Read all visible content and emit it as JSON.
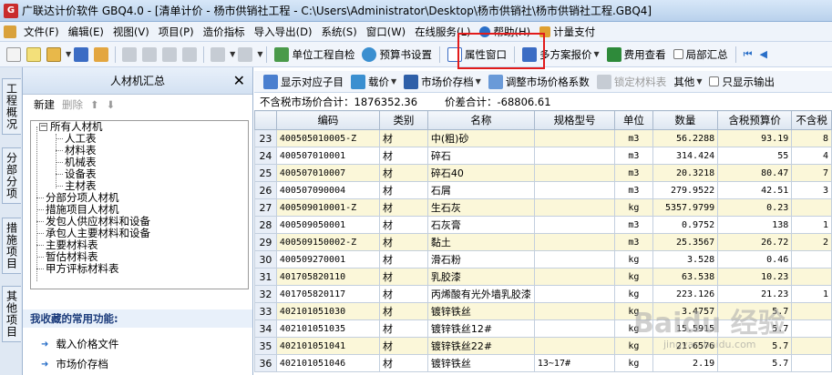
{
  "window": {
    "title": "广联达计价软件 GBQ4.0 - [清单计价 - 杨市供销社工程 - C:\\Users\\Administrator\\Desktop\\杨市供销社\\杨市供销社工程.GBQ4]"
  },
  "menu": [
    {
      "label": "文件(F)"
    },
    {
      "label": "编辑(E)"
    },
    {
      "label": "视图(V)"
    },
    {
      "label": "项目(P)"
    },
    {
      "label": "造价指标"
    },
    {
      "label": "导入导出(D)"
    },
    {
      "label": "系统(S)"
    },
    {
      "label": "窗口(W)"
    },
    {
      "label": "在线服务(L)"
    },
    {
      "label": "帮助(H)"
    },
    {
      "label": "计量支付"
    }
  ],
  "toolbar1": {
    "unit_check": "单位工程自检",
    "budget_settings": "预算书设置",
    "property_window": "属性窗口",
    "multi_quote": "多方案报价",
    "fee_view": "费用查看",
    "local_summary": "局部汇总"
  },
  "vtabs": [
    "工程概况",
    "分部分项",
    "措施项目",
    "其他项目"
  ],
  "left_panel": {
    "title": "人材机汇总",
    "new_label": "新建",
    "delete_label": "删除",
    "tree": {
      "root": "所有人材机",
      "children": [
        "人工表",
        "材料表",
        "机械表",
        "设备表",
        "主材表"
      ],
      "siblings": [
        "分部分项人材机",
        "措施项目人材机",
        "发包人供应材料和设备",
        "承包人主要材料和设备",
        "主要材料表",
        "暂估材料表",
        "甲方评标材料表"
      ]
    },
    "favorites_title": "我收藏的常用功能:",
    "favorites": [
      "载入价格文件",
      "市场价存档"
    ]
  },
  "toolbar2": {
    "show_sub": "显示对应子目",
    "load_price": "载价",
    "market_archive": "市场价存档",
    "adjust_coef": "调整市场价格系数",
    "lock_material": "锁定材料表",
    "other": "其他",
    "show_output": "只显示输出"
  },
  "summary": {
    "pretax_total": "不含税市场价合计：1876352.36",
    "diff_total": "价差合计：-68806.61"
  },
  "table": {
    "columns": [
      "",
      "编码",
      "类别",
      "名称",
      "规格型号",
      "单位",
      "数量",
      "含税预算价",
      "不含税"
    ],
    "rows": [
      [
        "23",
        "400505010005-Z",
        "材",
        "中(粗)砂",
        "",
        "m3",
        "56.2288",
        "93.19",
        "8"
      ],
      [
        "24",
        "400507010001",
        "材",
        "碎石",
        "",
        "m3",
        "314.424",
        "55",
        "4"
      ],
      [
        "25",
        "400507010007",
        "材",
        "碎石40",
        "",
        "m3",
        "20.3218",
        "80.47",
        "7"
      ],
      [
        "26",
        "400507090004",
        "材",
        "石屑",
        "",
        "m3",
        "279.9522",
        "42.51",
        "3"
      ],
      [
        "27",
        "400509010001-Z",
        "材",
        "生石灰",
        "",
        "kg",
        "5357.9799",
        "0.23",
        ""
      ],
      [
        "28",
        "400509050001",
        "材",
        "石灰膏",
        "",
        "m3",
        "0.9752",
        "138",
        "1"
      ],
      [
        "29",
        "400509150002-Z",
        "材",
        "黏土",
        "",
        "m3",
        "25.3567",
        "26.72",
        "2"
      ],
      [
        "30",
        "400509270001",
        "材",
        "滑石粉",
        "",
        "kg",
        "3.528",
        "0.46",
        ""
      ],
      [
        "31",
        "401705820110",
        "材",
        "乳胶漆",
        "",
        "kg",
        "63.538",
        "10.23",
        ""
      ],
      [
        "32",
        "401705820117",
        "材",
        "丙烯酸有光外墙乳胶漆",
        "",
        "kg",
        "223.126",
        "21.23",
        "1"
      ],
      [
        "33",
        "402101051030",
        "材",
        "镀锌铁丝",
        "",
        "kg",
        "3.4757",
        "5.7",
        ""
      ],
      [
        "34",
        "402101051035",
        "材",
        "镀锌铁丝12#",
        "",
        "kg",
        "15.5915",
        "5.7",
        ""
      ],
      [
        "35",
        "402101051041",
        "材",
        "镀锌铁丝22#",
        "",
        "kg",
        "21.6576",
        "5.7",
        ""
      ],
      [
        "36",
        "402101051046",
        "材",
        "镀锌铁丝",
        "13~17#",
        "kg",
        "2.19",
        "5.7",
        ""
      ]
    ]
  },
  "watermark": {
    "text": "Baidu 经验",
    "sub": "jingyan.baidu.com"
  },
  "colors": {
    "highlight_border": "#e21b1b",
    "row_highlight": "#fbf7d9",
    "title_bar": "#c8dcf3"
  }
}
